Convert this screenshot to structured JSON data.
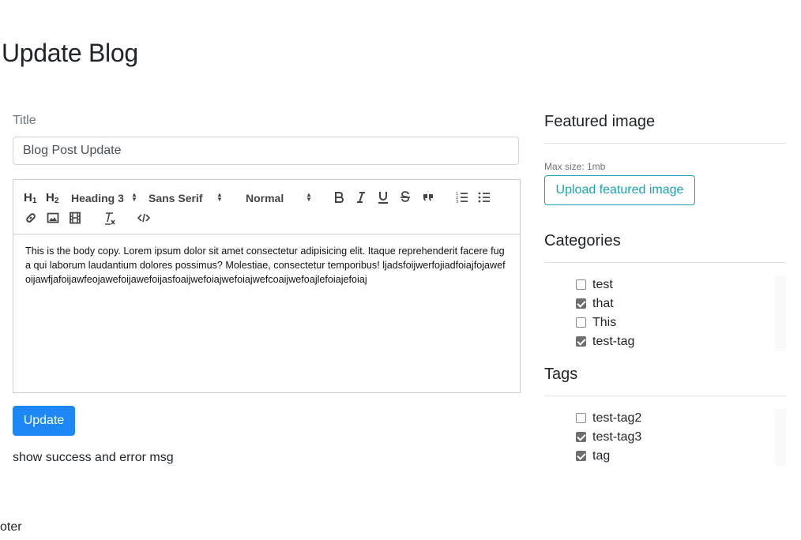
{
  "page": {
    "title": "Update Blog"
  },
  "form": {
    "title_label": "Title",
    "title_value": "Blog Post Update",
    "editor": {
      "toolbar": {
        "h1": "H",
        "h1_sub": "1",
        "h2": "H",
        "h2_sub": "2",
        "heading_picker": "Heading 3",
        "font_picker": "Sans Serif",
        "size_picker": "Normal",
        "picker_arrows": "▲▼"
      },
      "content": "This is the body copy. Lorem ipsum dolor sit amet consectetur adipisicing elit. Itaque reprehenderit facere fuga qui laborum laudantium dolores possimus? Molestiae, consectetur temporibus! ljadsfoijwerfojiadfoiajfojawefoijawfjafoijawfeojawefoijawefoijasfoaijwefoiajwefoiajwefcoaijwefoajlefoiajefoiaj"
    },
    "update_button": "Update",
    "status_message": "show success and error msg"
  },
  "sidebar": {
    "featured_image": {
      "title": "Featured image",
      "max_size_note": "Max size: 1mb",
      "upload_button": "Upload featured image"
    },
    "categories": {
      "title": "Categories",
      "items": [
        {
          "label": "test",
          "checked": false
        },
        {
          "label": "that",
          "checked": true
        },
        {
          "label": "This",
          "checked": false
        },
        {
          "label": "test-tag",
          "checked": true
        }
      ]
    },
    "tags": {
      "title": "Tags",
      "items": [
        {
          "label": "test-tag2",
          "checked": false
        },
        {
          "label": "test-tag3",
          "checked": true
        },
        {
          "label": "tag",
          "checked": true
        }
      ]
    }
  },
  "footer": {
    "text": "oter"
  },
  "colors": {
    "primary": "#1d88f5",
    "info": "#17a2b8",
    "text": "#212529",
    "muted": "#6c757d"
  }
}
